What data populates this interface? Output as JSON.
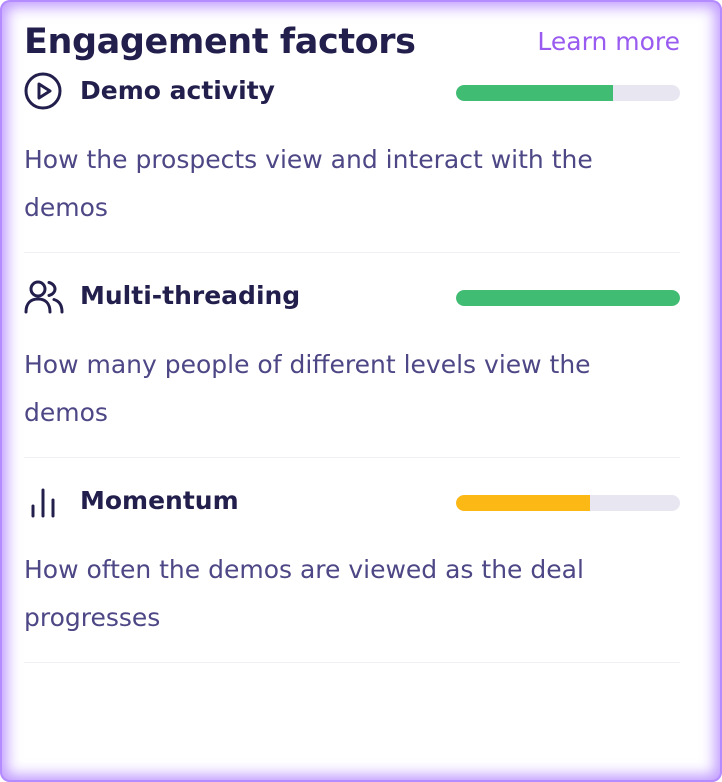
{
  "header": {
    "title": "Engagement factors",
    "learn_more": "Learn more"
  },
  "factors": [
    {
      "name": "Demo activity",
      "icon": "play-circle-icon",
      "description": "How the prospects view and interact with the demos",
      "score": 0.7,
      "color": "#40bd73"
    },
    {
      "name": "Multi-threading",
      "icon": "users-icon",
      "description": "How many people of different levels view the demos",
      "score": 1.0,
      "color": "#40bd73"
    },
    {
      "name": "Momentum",
      "icon": "bar-chart-icon",
      "description": "How often the demos are viewed as the deal progresses",
      "score": 0.6,
      "color": "#fcb814"
    }
  ]
}
